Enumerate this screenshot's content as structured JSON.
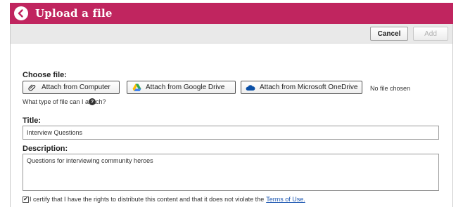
{
  "header": {
    "title": "Upload a file",
    "accent_color": "#c0255f",
    "back_icon": "arrow-left-circle-icon"
  },
  "toolbar": {
    "cancel_label": "Cancel",
    "add_label": "Add"
  },
  "choose_file": {
    "label": "Choose file:",
    "computer_label": "Attach from Computer",
    "google_label": "Attach from Google Drive",
    "onedrive_label": "Attach from Microsoft OneDrive",
    "status": "No file chosen",
    "help_text": "What type of file can I attach?"
  },
  "title_field": {
    "label": "Title:",
    "value": "Interview Questions"
  },
  "description_field": {
    "label": "Description:",
    "value": "Questions for interviewing community heroes"
  },
  "certify": {
    "checked": true,
    "text": "I certify that I have the rights to distribute this content and that it does not violate the",
    "link_text": "Terms of Use."
  }
}
